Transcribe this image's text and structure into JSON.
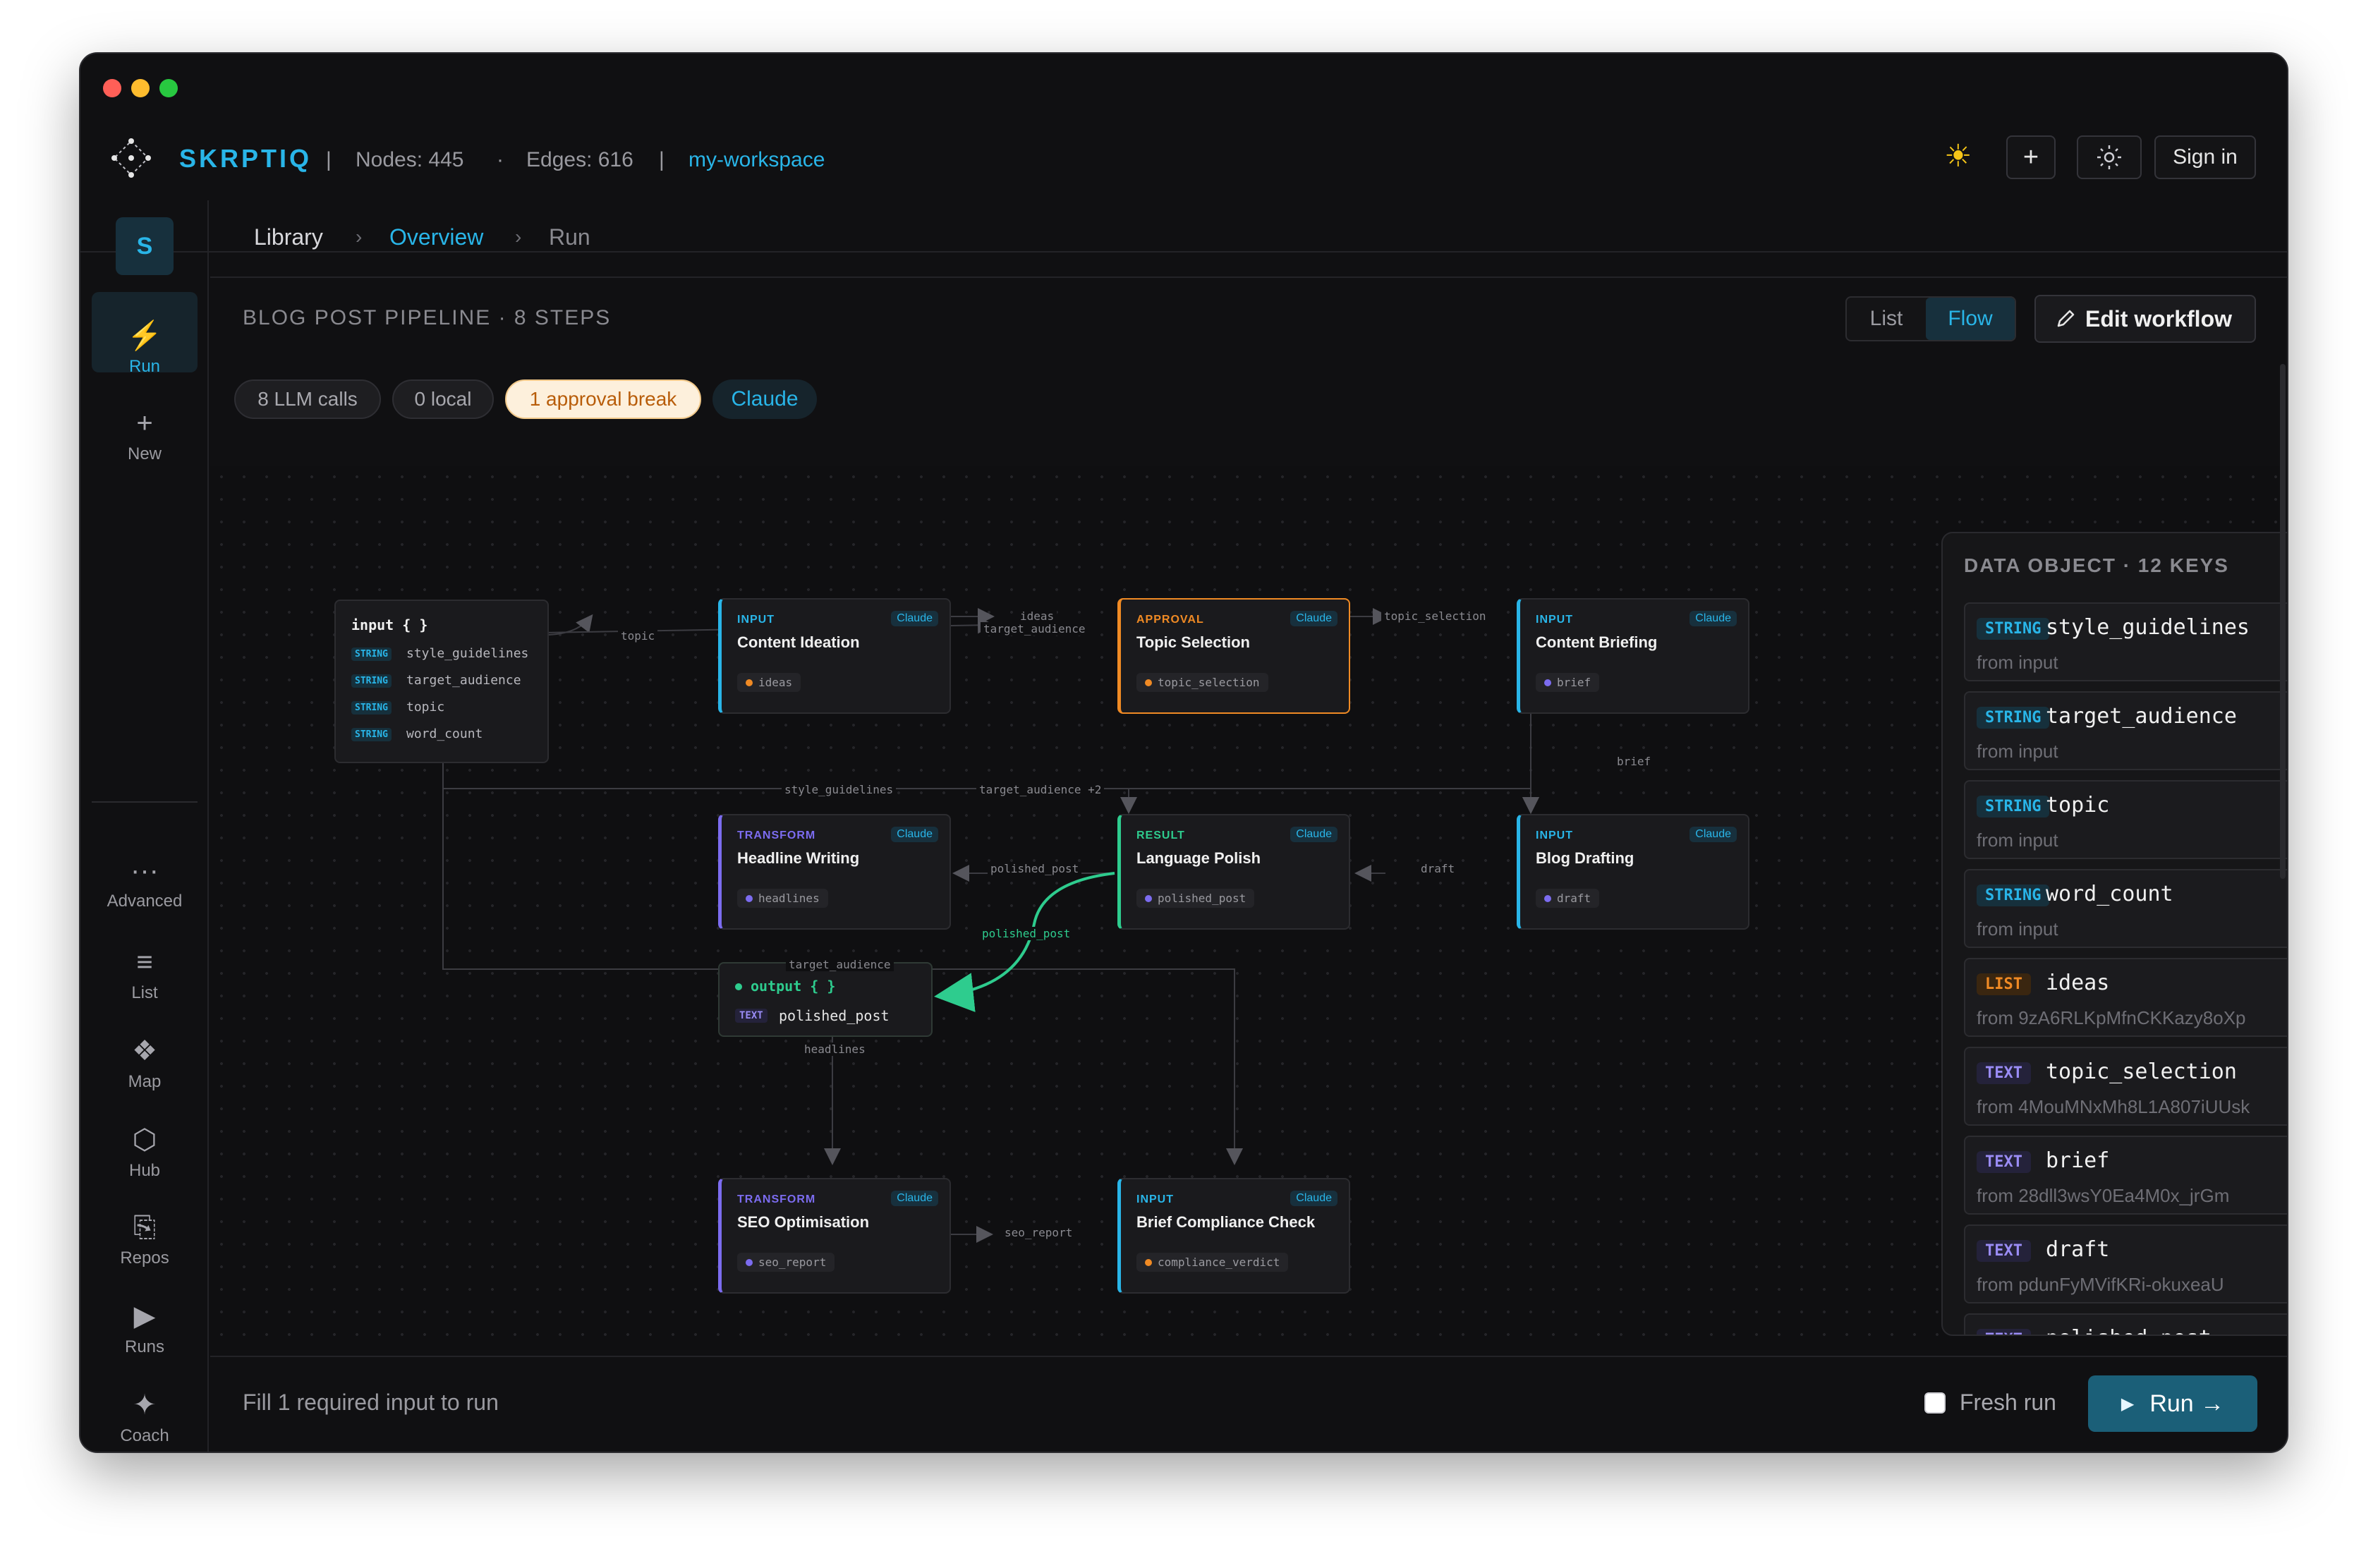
{
  "topbar": {
    "brand": "SKRPTIQ",
    "sep1": "|",
    "nodes": "Nodes: 445",
    "dot": "·",
    "edges": "Edges: 616",
    "sep2": "|",
    "workspace": "my-workspace",
    "plus": "+",
    "sign_in": "Sign in"
  },
  "sidebar": {
    "avatar": "S",
    "items": [
      {
        "label": "Run",
        "icon": "lightning-icon"
      },
      {
        "label": "New",
        "icon": "plus-icon"
      },
      {
        "label": "Advanced",
        "icon": "ellipsis-icon"
      },
      {
        "label": "List",
        "icon": "list-icon"
      },
      {
        "label": "Map",
        "icon": "map-icon"
      },
      {
        "label": "Hub",
        "icon": "hexagon-icon"
      },
      {
        "label": "Repos",
        "icon": "repos-icon"
      },
      {
        "label": "Runs",
        "icon": "play-icon"
      },
      {
        "label": "Coach",
        "icon": "sparkle-icon"
      }
    ],
    "icon_glyphs": [
      "⚡",
      "+",
      "···",
      "≡",
      "❖",
      "⬡",
      "⎘",
      "▶",
      "✦"
    ]
  },
  "breadcrumb": {
    "items": [
      "Library",
      "Overview",
      "Run"
    ],
    "sep": "›"
  },
  "pipeline": {
    "title": "BLOG POST PIPELINE · 8 STEPS",
    "view_list": "List",
    "view_flow": "Flow",
    "edit_label": "Edit workflow"
  },
  "chips": [
    "8 LLM calls",
    "0 local",
    "1 approval break",
    "Claude"
  ],
  "input_node": {
    "title": "input { }",
    "fields": [
      {
        "type": "STRING",
        "name": "style_guidelines"
      },
      {
        "type": "STRING",
        "name": "target_audience"
      },
      {
        "type": "STRING",
        "name": "topic"
      },
      {
        "type": "STRING",
        "name": "word_count"
      }
    ]
  },
  "nodes": [
    {
      "kind": "INPUT",
      "provider": "Claude",
      "title": "Content Ideation",
      "output": "ideas"
    },
    {
      "kind": "APPROVAL",
      "provider": "Claude",
      "title": "Topic Selection",
      "output": "topic_selection"
    },
    {
      "kind": "INPUT",
      "provider": "Claude",
      "title": "Content Briefing",
      "output": "brief"
    },
    {
      "kind": "TRANSFORM",
      "provider": "Claude",
      "title": "Headline Writing",
      "output": "headlines"
    },
    {
      "kind": "RESULT",
      "provider": "Claude",
      "title": "Language Polish",
      "output": "polished_post"
    },
    {
      "kind": "INPUT",
      "provider": "Claude",
      "title": "Blog Drafting",
      "output": "draft"
    },
    {
      "kind": "TRANSFORM",
      "provider": "Claude",
      "title": "SEO Optimisation",
      "output": "seo_report"
    },
    {
      "kind": "INPUT",
      "provider": "Claude",
      "title": "Brief Compliance Check",
      "output": "compliance_verdict"
    }
  ],
  "output_node": {
    "title": "output { }",
    "field_type": "TEXT",
    "field": "polished_post"
  },
  "edge_labels": [
    "topic",
    "ideas",
    "target_audience",
    "topic_selection",
    "brief",
    "style_guidelines",
    "target_audience +2",
    "polished_post",
    "draft",
    "polished_post",
    "target_audience",
    "headlines",
    "seo_report"
  ],
  "data_object": {
    "title": "DATA OBJECT · 12 KEYS",
    "entries": [
      {
        "type": "STRING",
        "key": "style_guidelines",
        "from": "from input"
      },
      {
        "type": "STRING",
        "key": "target_audience",
        "from": "from input"
      },
      {
        "type": "STRING",
        "key": "topic",
        "from": "from input"
      },
      {
        "type": "STRING",
        "key": "word_count",
        "from": "from input"
      },
      {
        "type": "LIST",
        "key": "ideas",
        "from": "from 9zA6RLKpMfnCKKazy8oXp"
      },
      {
        "type": "TEXT",
        "key": "topic_selection",
        "from": "from 4MouMNxMh8L1A807iUUsk"
      },
      {
        "type": "TEXT",
        "key": "brief",
        "from": "from 28dll3wsY0Ea4M0x_jrGm"
      },
      {
        "type": "TEXT",
        "key": "draft",
        "from": "from pdunFyMVifKRi-okuxeaU"
      },
      {
        "type": "TEXT",
        "key": "polished_post",
        "from": ""
      }
    ]
  },
  "bottom": {
    "hint": "Fill 1 required input to run",
    "fresh_run": "Fresh run",
    "run_label": "Run →"
  },
  "colors": {
    "accent": "#29b5e8",
    "input": "#29b5e8",
    "approval": "#f08a24",
    "transform": "#7c6cf0",
    "result": "#2ecc8e",
    "output": "#2ecc8e"
  }
}
